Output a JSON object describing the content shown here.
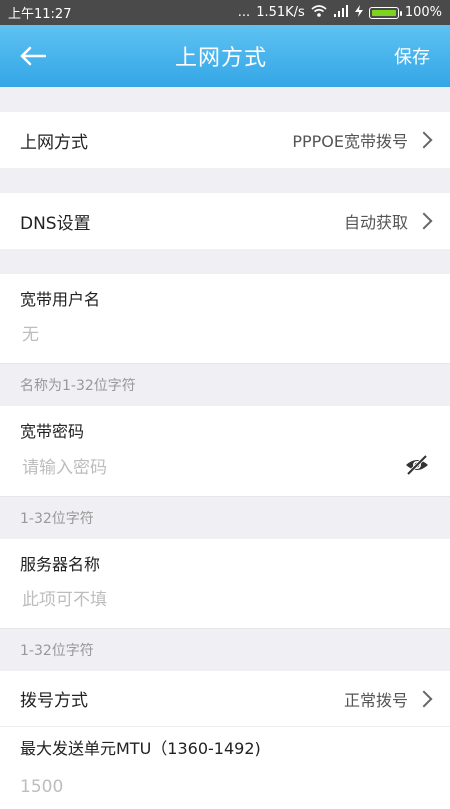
{
  "status": {
    "time": "上午11:27",
    "dots": "...",
    "speed": "1.51K/s",
    "battery": "100%"
  },
  "header": {
    "title": "上网方式",
    "save_label": "保存"
  },
  "rows": {
    "connection_type": {
      "label": "上网方式",
      "value": "PPPOE宽带拨号"
    },
    "dns": {
      "label": "DNS设置",
      "value": "自动获取"
    }
  },
  "fields": {
    "username": {
      "label": "宽带用户名",
      "value": "无",
      "hint": "名称为1-32位字符"
    },
    "password": {
      "label": "宽带密码",
      "placeholder": "请输入密码",
      "hint": "1-32位字符"
    },
    "server": {
      "label": "服务器名称",
      "placeholder": "此项可不填",
      "hint": "1-32位字符"
    }
  },
  "dial": {
    "label": "拨号方式",
    "value": "正常拨号"
  },
  "mtu": {
    "label": "最大发送单元MTU（1360-1492)",
    "value": "1500"
  }
}
